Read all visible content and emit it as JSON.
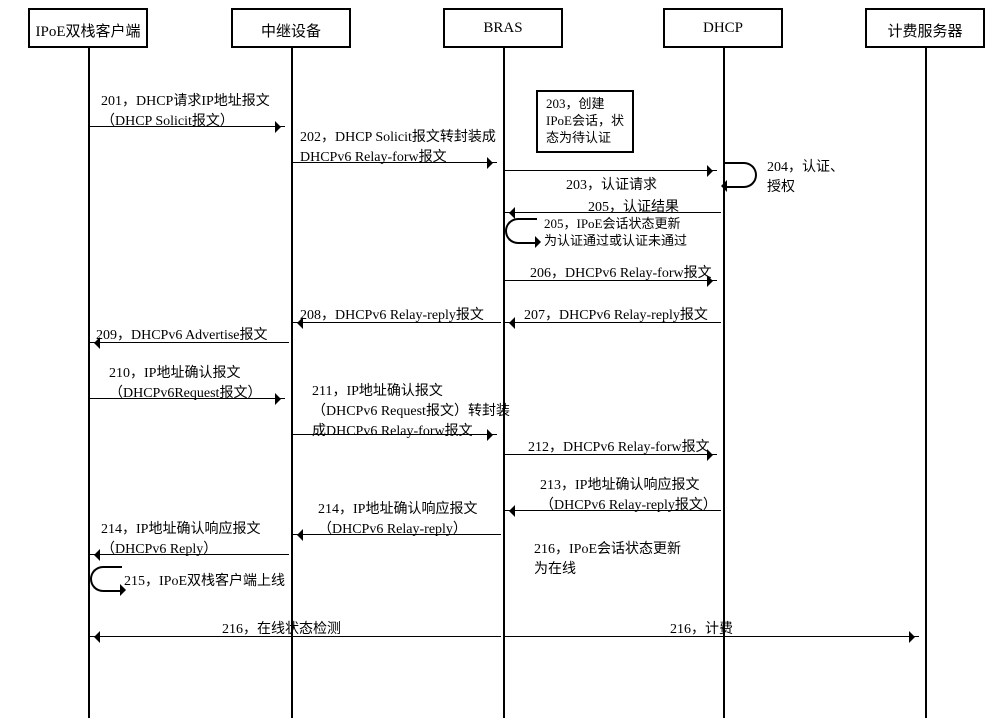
{
  "actors": {
    "client": "IPoE双栈客户端",
    "relay": "中继设备",
    "bras": "BRAS",
    "dhcp": "DHCP",
    "billing": "计费服务器"
  },
  "messages": {
    "m201a": "201，DHCP请求IP地址报文",
    "m201b": "（DHCP Solicit报文）",
    "m202a": "202，DHCP Solicit报文转封装成",
    "m202b": "DHCPv6 Relay-forw报文",
    "m203": "203，认证请求",
    "m203box_a": "203，创建",
    "m203box_b": "IPoE会话，状",
    "m203box_c": "态为待认证",
    "m204a": "204，认证、",
    "m204b": "授权",
    "m205": "205，认证结果",
    "m205self_a": "205，IPoE会话状态更新",
    "m205self_b": "为认证通过或认证未通过",
    "m206": "206，DHCPv6 Relay-forw报文",
    "m207": "207，DHCPv6 Relay-reply报文",
    "m208": "208，DHCPv6 Relay-reply报文",
    "m209": "209，DHCPv6  Advertise报文",
    "m210a": "210，IP地址确认报文",
    "m210b": "（DHCPv6Request报文）",
    "m211a": "211，IP地址确认报文",
    "m211b": "（DHCPv6 Request报文）转封装",
    "m211c": "成DHCPv6 Relay-forw报文",
    "m212": "212，DHCPv6 Relay-forw报文",
    "m213a": "213，IP地址确认响应报文",
    "m213b": "（DHCPv6 Relay-reply报文）",
    "m214a": "214，IP地址确认响应报文",
    "m214b": "（DHCPv6 Reply）",
    "m214_relay_a": "214，IP地址确认响应报文",
    "m214_relay_b": "（DHCPv6 Relay-reply）",
    "m215": "215，IPoE双栈客户端上线",
    "m216self_a": "216，IPoE会话状态更新",
    "m216self_b": "为在线",
    "m216_detect": "216，在线状态检测",
    "m216_bill": "216，计费"
  }
}
